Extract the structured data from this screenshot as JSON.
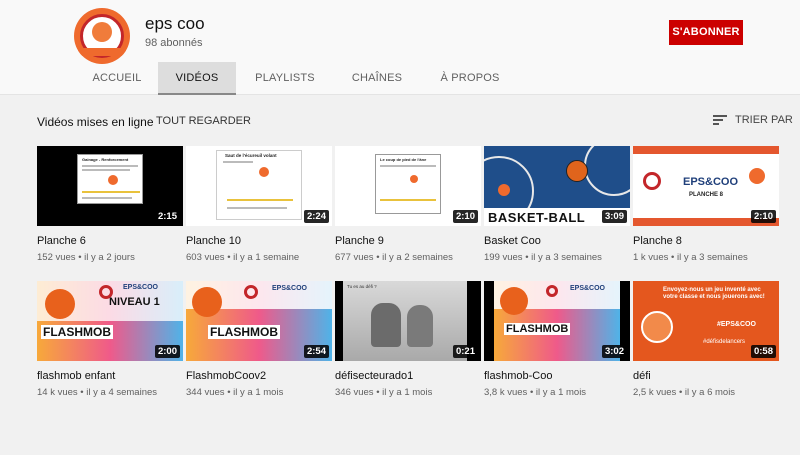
{
  "channel": {
    "name": "eps coo",
    "subscribers": "98 abonnés",
    "subscribe_label": "S'ABONNER"
  },
  "tabs": [
    "ACCUEIL",
    "VIDÉOS",
    "PLAYLISTS",
    "CHAÎNES",
    "À PROPOS"
  ],
  "section": {
    "title": "Vidéos mises en ligne",
    "play_all": "TOUT REGARDER",
    "sort": "TRIER PAR"
  },
  "videos": [
    {
      "title": "Planche 6",
      "meta": "152 vues • il y a 2 jours",
      "duration": "2:15"
    },
    {
      "title": "Planche 10",
      "meta": "603 vues • il y a 1 semaine",
      "duration": "2:24"
    },
    {
      "title": "Planche 9",
      "meta": "677 vues • il y a 2 semaines",
      "duration": "2:10"
    },
    {
      "title": "Basket Coo",
      "meta": "199 vues • il y a 3 semaines",
      "duration": "3:09"
    },
    {
      "title": "Planche 8",
      "meta": "1 k vues • il y a 3 semaines",
      "duration": "2:10"
    },
    {
      "title": "flashmob enfant",
      "meta": "14 k vues • il y a 4 semaines",
      "duration": "2:00"
    },
    {
      "title": "FlashmobCoov2",
      "meta": "344 vues • il y a 1 mois",
      "duration": "2:54"
    },
    {
      "title": "défisecteurado1",
      "meta": "346 vues • il y a 1 mois",
      "duration": "0:21"
    },
    {
      "title": "flashmob-Coo",
      "meta": "3,8 k vues • il y a 1 mois",
      "duration": "3:02"
    },
    {
      "title": "défi",
      "meta": "2,5 k vues • il y a 6 mois",
      "duration": "0:58"
    }
  ],
  "thumb_text": {
    "t1": "Gainage - Renforcement",
    "t2": "Saut de l'écureuil volant",
    "t3": "Le coup de pied de l'âne",
    "t4": "BASKET-BALL",
    "t5_brand": "EPS&COO",
    "t5_sub": "PLANCHE 8",
    "t6_brand": "EPS&COO",
    "t6_level": "NIVEAU 1",
    "t6_word": "FLASHMOB",
    "t7_brand": "EPS&COO",
    "t7_word": "FLASHMOB",
    "t8_caption": "Tu es au défi ?",
    "t9_brand": "EPS&COO",
    "t9_word": "FLASHMOB",
    "t10_text": "Envoyez-nous un jeu inventé avec votre classe et nous jouerons avec!",
    "t10_brand": "#EPS&COO",
    "t10_tag": "#défisdelancers"
  },
  "colors": {
    "accent": "#cc0000",
    "brand_orange": "#ef6a2d"
  },
  "icons": {
    "sort": "sort-lines-icon"
  }
}
